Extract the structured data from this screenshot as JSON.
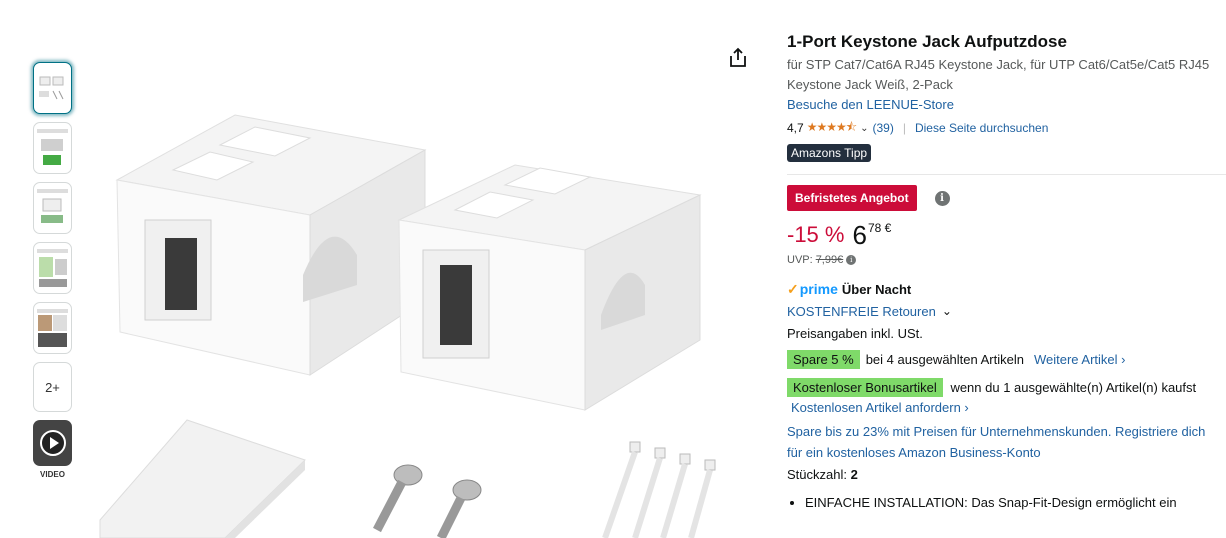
{
  "gallery": {
    "more_label": "2+",
    "video_label": "VIDEO"
  },
  "product": {
    "title": "1-Port Keystone Jack Aufputzdose",
    "subtitle": "für STP Cat7/Cat6A RJ45 Keystone Jack, für UTP Cat6/Cat5e/Cat5 RJ45 Keystone Jack Weiß, 2-Pack",
    "store_link": "Besuche den LEENUE-Store",
    "rating_value": "4,7",
    "rating_stars": "★★★★⯪",
    "rating_count": "(39)",
    "search_page": "Diese Seite durchsuchen",
    "tipp_badge": "Amazons Tipp"
  },
  "pricing": {
    "deal_badge": "Befristetes Angebot",
    "discount": "-15 %",
    "price_whole": "6",
    "price_fraction": "78 €",
    "uvp_label": "UVP:",
    "uvp_value": "7,99€"
  },
  "delivery": {
    "prime_label": "prime",
    "prime_text": "Über Nacht",
    "returns": "KOSTENFREIE Retouren",
    "tax": "Preisangaben inkl. USt."
  },
  "offers": {
    "coupon_badge": "Spare 5 %",
    "coupon_text": "bei 4 ausgewählten Artikeln",
    "coupon_link": "Weitere Artikel ›",
    "bonus_badge": "Kostenloser Bonusartikel",
    "bonus_text": "wenn du 1 ausgewählte(n) Artikel(n) kaufst",
    "bonus_link": "Kostenlosen Artikel anfordern ›",
    "business": "Spare bis zu 23% mit Preisen für Unternehmenskunden. Registriere dich für ein kostenloses Amazon Business-Konto"
  },
  "quantity": {
    "label": "Stückzahl:",
    "value": "2"
  },
  "bullets": [
    "EINFACHE INSTALLATION: Das Snap-Fit-Design ermöglicht ein"
  ],
  "colors": {
    "accent_red": "#cc0c39",
    "link_blue": "#2162a1",
    "star_orange": "#de7921",
    "green_badge": "#7fda69",
    "prime_blue": "#1399ff"
  }
}
